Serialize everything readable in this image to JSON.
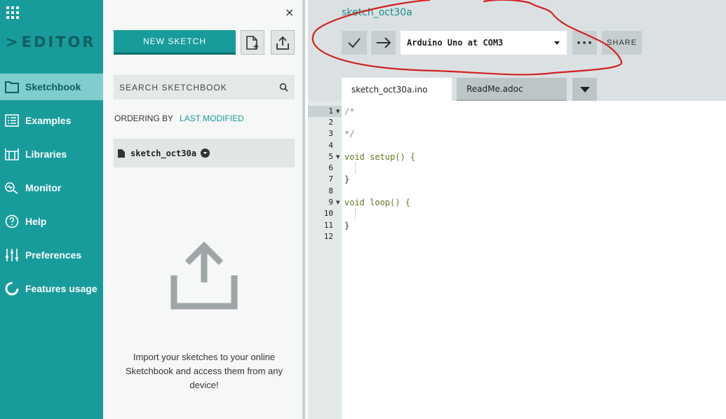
{
  "nav": {
    "brand": "EDITOR",
    "items": [
      {
        "label": "Sketchbook",
        "icon": "folder-icon",
        "active": true
      },
      {
        "label": "Examples",
        "icon": "list-icon",
        "active": false
      },
      {
        "label": "Libraries",
        "icon": "libraries-icon",
        "active": false
      },
      {
        "label": "Monitor",
        "icon": "monitor-icon",
        "active": false
      },
      {
        "label": "Help",
        "icon": "help-icon",
        "active": false
      },
      {
        "label": "Preferences",
        "icon": "sliders-icon",
        "active": false
      },
      {
        "label": "Features usage",
        "icon": "pie-icon",
        "active": false
      }
    ]
  },
  "panel": {
    "close": "×",
    "new_sketch_label": "NEW SKETCH",
    "search_placeholder": "SEARCH SKETCHBOOK",
    "ordering_label": "ORDERING BY",
    "ordering_value": "LAST MODIFIED",
    "sketch_name": "sketch_oct30a",
    "import_text": "Import your sketches to your online Sketchbook and access them from any device!"
  },
  "editor": {
    "sketch_title": "sketch_oct30a",
    "board": "Arduino Uno at COM3",
    "more": "•••",
    "share_label": "SHARE",
    "tabs": [
      {
        "label": "sketch_oct30a.ino",
        "active": true
      },
      {
        "label": "ReadMe.adoc",
        "active": false
      }
    ],
    "lines": [
      "/*",
      "",
      "*/",
      "",
      "void setup() {",
      "",
      "}",
      "",
      "void loop() {",
      "",
      "}",
      ""
    ],
    "line_numbers": [
      "1",
      "2",
      "3",
      "4",
      "5",
      "6",
      "7",
      "8",
      "9",
      "10",
      "11",
      "12"
    ]
  },
  "colors": {
    "accent": "#179c9b",
    "annotation": "#d42020"
  }
}
